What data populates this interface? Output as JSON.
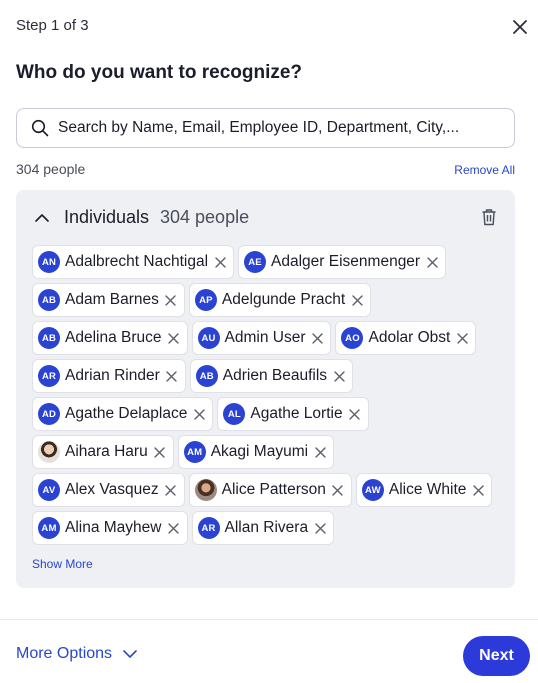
{
  "header": {
    "step": "Step 1 of 3",
    "title": "Who do you want to recognize?"
  },
  "search": {
    "placeholder": "Search by Name, Email, Employee ID, Department, City,..."
  },
  "summary": {
    "count": "304 people",
    "remove_all": "Remove All"
  },
  "group": {
    "name": "Individuals",
    "count": "304 people",
    "show_more": "Show More",
    "rows": [
      [
        {
          "initials": "AN",
          "name": "Adalbrecht Nachtigal"
        },
        {
          "initials": "AE",
          "name": "Adalger Eisenmenger"
        }
      ],
      [
        {
          "initials": "AB",
          "name": "Adam Barnes"
        },
        {
          "initials": "AP",
          "name": "Adelgunde Pracht"
        }
      ],
      [
        {
          "initials": "AB",
          "name": "Adelina Bruce"
        },
        {
          "initials": "AU",
          "name": "Admin User"
        },
        {
          "initials": "AO",
          "name": "Adolar Obst"
        }
      ],
      [
        {
          "initials": "AR",
          "name": "Adrian Rinder"
        },
        {
          "initials": "AB",
          "name": "Adrien Beaufils"
        }
      ],
      [
        {
          "initials": "AD",
          "name": "Agathe Delaplace"
        },
        {
          "initials": "AL",
          "name": "Agathe Lortie"
        }
      ],
      [
        {
          "initials": "",
          "name": "Aihara Haru",
          "photo": true
        },
        {
          "initials": "AM",
          "name": "Akagi Mayumi"
        }
      ],
      [
        {
          "initials": "AV",
          "name": "Alex Vasquez"
        },
        {
          "initials": "",
          "name": "Alice Patterson",
          "photo": true
        },
        {
          "initials": "AW",
          "name": "Alice White"
        }
      ],
      [
        {
          "initials": "AM",
          "name": "Alina Mayhew"
        },
        {
          "initials": "AR",
          "name": "Allan Rivera"
        }
      ]
    ]
  },
  "footer": {
    "more_options": "More Options",
    "next": "Next"
  },
  "colors": {
    "accent": "#2b3ad8",
    "avatar": "#2b43d3",
    "link": "#2a47c8",
    "panel": "#eef0f3"
  }
}
